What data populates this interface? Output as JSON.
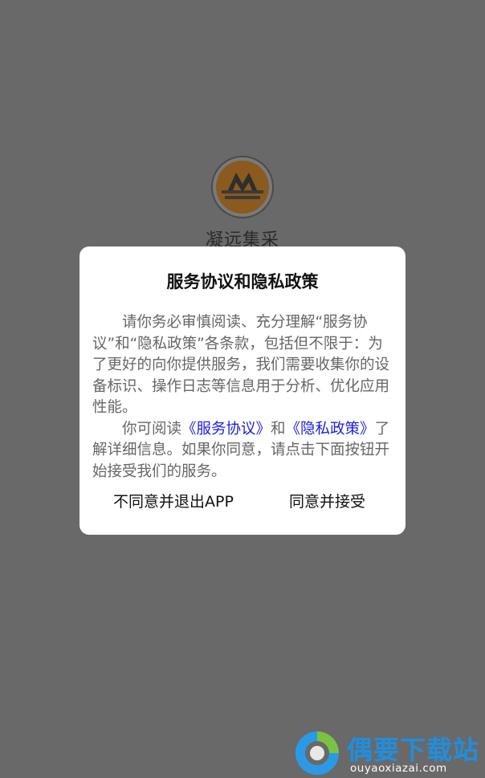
{
  "app": {
    "name": "凝远集采",
    "logo_icon": "company-logo-icon"
  },
  "dialog": {
    "title": "服务协议和隐私政策",
    "para1": "请你务必审慎阅读、充分理解“服务协议”和“隐私政策”各条款，包括但不限于：为了更好的向你提供服务，我们需要收集你的设备标识、操作日志等信息用于分析、优化应用性能。",
    "para2_prefix": "你可阅读",
    "link_service": "《服务协议》",
    "and_text": "和",
    "link_privacy": "《隐私政策》",
    "para2_suffix": "了解详细信息。如果你同意，请点击下面按钮开始接受我们的服务。",
    "btn_disagree": "不同意并退出APP",
    "btn_agree": "同意并接受"
  },
  "watermark": {
    "text": "偶要下载站",
    "url": "ouyaoxiazai.com"
  },
  "colors": {
    "overlay": "#696969",
    "link": "#1f1fd6",
    "watermark": "#1e8fe0"
  }
}
